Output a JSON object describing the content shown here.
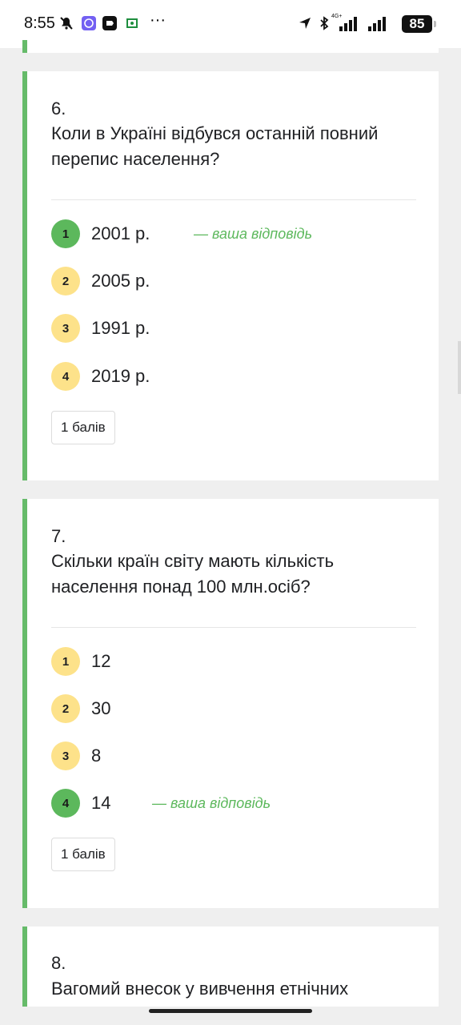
{
  "status_bar": {
    "time": "8:55",
    "battery": "85",
    "network": "4G+",
    "icons": [
      "mute-icon",
      "viber-icon",
      "app-icon",
      "classroom-icon",
      "more-icon",
      "location-icon",
      "bluetooth-icon",
      "signal-icon"
    ]
  },
  "colors": {
    "accent_green": "#66bb6a",
    "bubble_yellow": "#fde28a",
    "bubble_chosen": "#5cb85c"
  },
  "questions": [
    {
      "number": "6.",
      "text": "Коли в Україні відбувся останній повний перепис населення?",
      "options": [
        {
          "index": "1",
          "text": "2001 р.",
          "chosen": true
        },
        {
          "index": "2",
          "text": "2005 р.",
          "chosen": false
        },
        {
          "index": "3",
          "text": "1991 р.",
          "chosen": false
        },
        {
          "index": "4",
          "text": "2019 р.",
          "chosen": false
        }
      ],
      "your_answer_label": "— ваша відповідь",
      "points": "1 балів"
    },
    {
      "number": "7.",
      "text": "Скільки країн світу мають кількість населення понад 100 млн.осіб?",
      "options": [
        {
          "index": "1",
          "text": "12",
          "chosen": false
        },
        {
          "index": "2",
          "text": "30",
          "chosen": false
        },
        {
          "index": "3",
          "text": "8",
          "chosen": false
        },
        {
          "index": "4",
          "text": "14",
          "chosen": true
        }
      ],
      "your_answer_label": "— ваша відповідь",
      "points": "1 балів"
    },
    {
      "number": "8.",
      "text": "Вагомий внесок у вивчення етнічних"
    }
  ]
}
